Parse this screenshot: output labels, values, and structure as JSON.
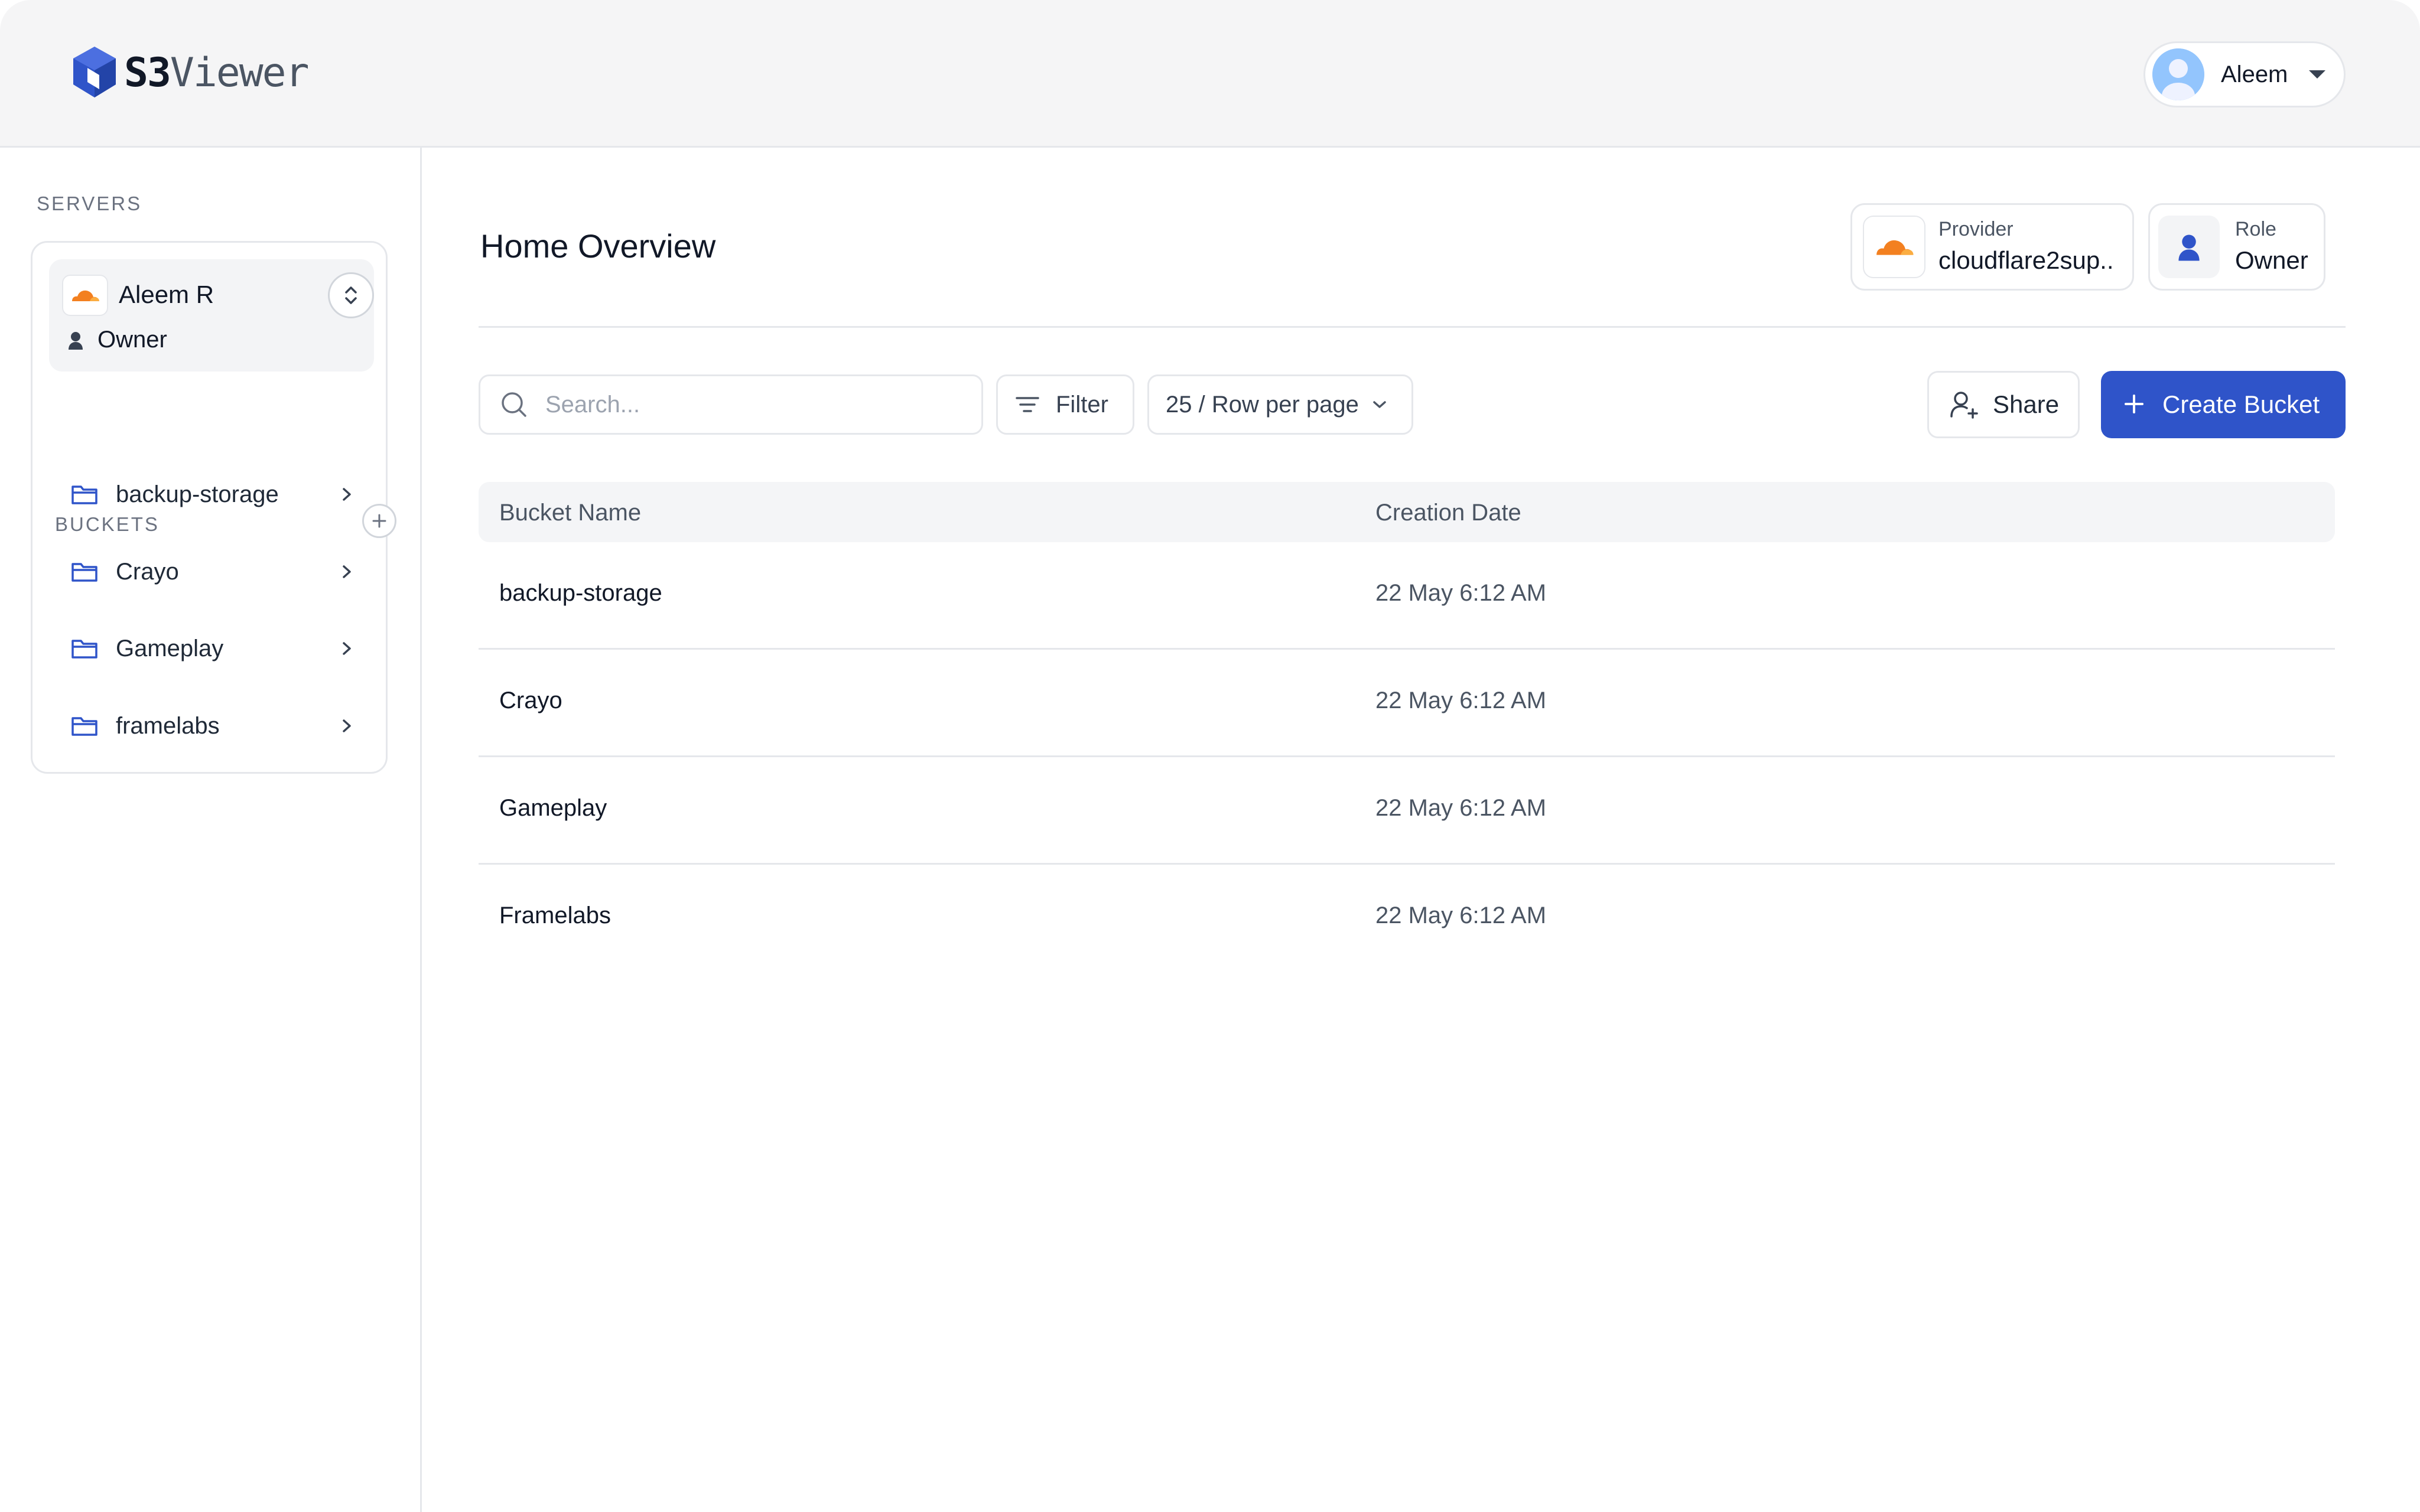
{
  "app": {
    "logo_bold": "S3",
    "logo_rest": "Viewer"
  },
  "user": {
    "name": "Aleem"
  },
  "sidebar": {
    "servers_label": "SERVERS",
    "server": {
      "name": "Aleem R",
      "role": "Owner",
      "provider_icon": "cloudflare-icon"
    },
    "buckets_label": "BUCKETS",
    "buckets": [
      {
        "label": "backup-storage"
      },
      {
        "label": "Crayo"
      },
      {
        "label": "Gameplay"
      },
      {
        "label": "framelabs"
      }
    ]
  },
  "main": {
    "title": "Home Overview",
    "provider": {
      "label": "Provider",
      "value": "cloudflare2sup.."
    },
    "role": {
      "label": "Role",
      "value": "Owner"
    },
    "search": {
      "placeholder": "Search..."
    },
    "filter_label": "Filter",
    "rows_per_page": "25 / Row per page",
    "share_label": "Share",
    "create_label": "Create Bucket",
    "table": {
      "columns": [
        "Bucket Name",
        "Creation Date"
      ],
      "rows": [
        {
          "name": "backup-storage",
          "date": "22 May 6:12 AM"
        },
        {
          "name": "Crayo",
          "date": "22 May 6:12 AM"
        },
        {
          "name": "Gameplay",
          "date": "22 May 6:12 AM"
        },
        {
          "name": "Framelabs",
          "date": "22 May 6:12 AM"
        }
      ]
    }
  },
  "colors": {
    "accent": "#2f54c9",
    "cloudflare": "#f38020",
    "header_bg": "#f5f5f6"
  }
}
